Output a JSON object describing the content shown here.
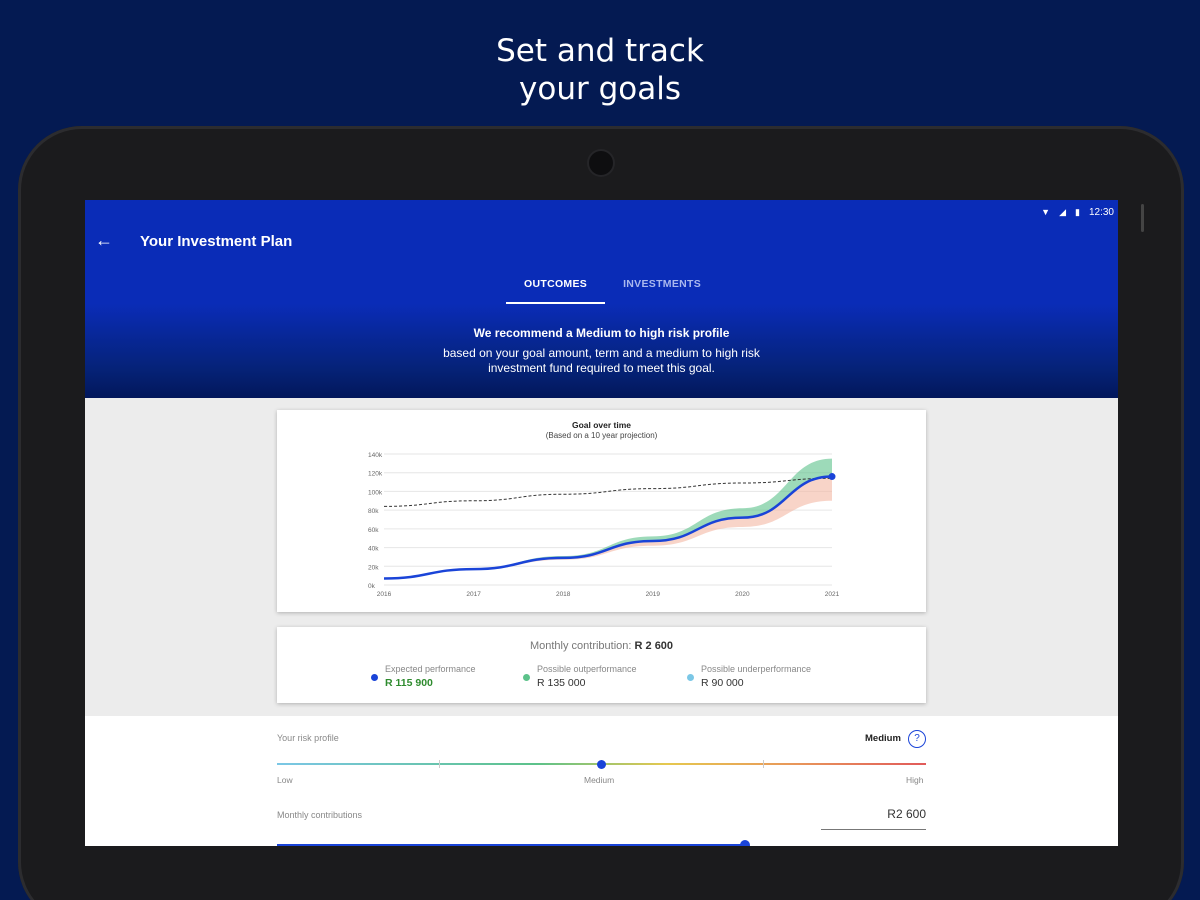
{
  "promo": {
    "line1": "Set and track",
    "line2": "your goals"
  },
  "status_bar": {
    "time": "12:30",
    "wifi_icon": "wifi-icon",
    "signal_icon": "signal-icon",
    "battery_icon": "battery-icon"
  },
  "app_bar": {
    "title": "Your Investment Plan",
    "back_icon": "arrow-back-icon"
  },
  "tabs": [
    {
      "label": "OUTCOMES",
      "active": true
    },
    {
      "label": "INVESTMENTS",
      "active": false
    }
  ],
  "banner": {
    "title": "We recommend a Medium to high risk profile",
    "text": "based on your goal amount, term and a medium to high risk investment fund required to meet this goal."
  },
  "chart_data": {
    "type": "line",
    "title": "Goal over time",
    "subtitle": "(Based on a 10 year projection)",
    "x": [
      2016,
      2017,
      2018,
      2019,
      2020,
      2021
    ],
    "ylim": [
      0,
      140000
    ],
    "y_ticks": [
      "0k",
      "20k",
      "40k",
      "60k",
      "80k",
      "100k",
      "120k",
      "140k"
    ],
    "x_ticks": [
      "2016",
      "2017",
      "2018",
      "2019",
      "2020",
      "2021"
    ],
    "grid": true,
    "series": [
      {
        "values": [
          7000,
          17000,
          29000,
          47000,
          72000,
          115900
        ],
        "color": "#1a44d8"
      },
      {
        "values": [
          7000,
          17500,
          31000,
          52000,
          82000,
          135000
        ],
        "color": "#5cc28a"
      },
      {
        "values": [
          7000,
          16000,
          27000,
          42000,
          62000,
          90000
        ],
        "color": "#f4b8a3"
      },
      {
        "values": [
          84000,
          90000,
          97000,
          103000,
          109000,
          114000
        ],
        "color": "#333333"
      }
    ]
  },
  "stats": {
    "monthly_label": "Monthly contribution:",
    "monthly_value": "R 2 600",
    "items": [
      {
        "label": "Expected performance",
        "value": "R 115 900",
        "color": "#1a44d8"
      },
      {
        "label": "Possible outperformance",
        "value": "R 135 000",
        "color": "#5cc28a"
      },
      {
        "label": "Possible underperformance",
        "value": "R 90 000",
        "color": "#7bc7e6"
      }
    ]
  },
  "risk": {
    "label": "Your risk profile",
    "value": "Medium",
    "help_icon": "help-circle-icon",
    "help_glyph": "?",
    "low": "Low",
    "medium": "Medium",
    "high": "High",
    "level": 0.5
  },
  "contributions": {
    "label": "Monthly contributions",
    "value": "R2 600",
    "level": 0.72
  }
}
